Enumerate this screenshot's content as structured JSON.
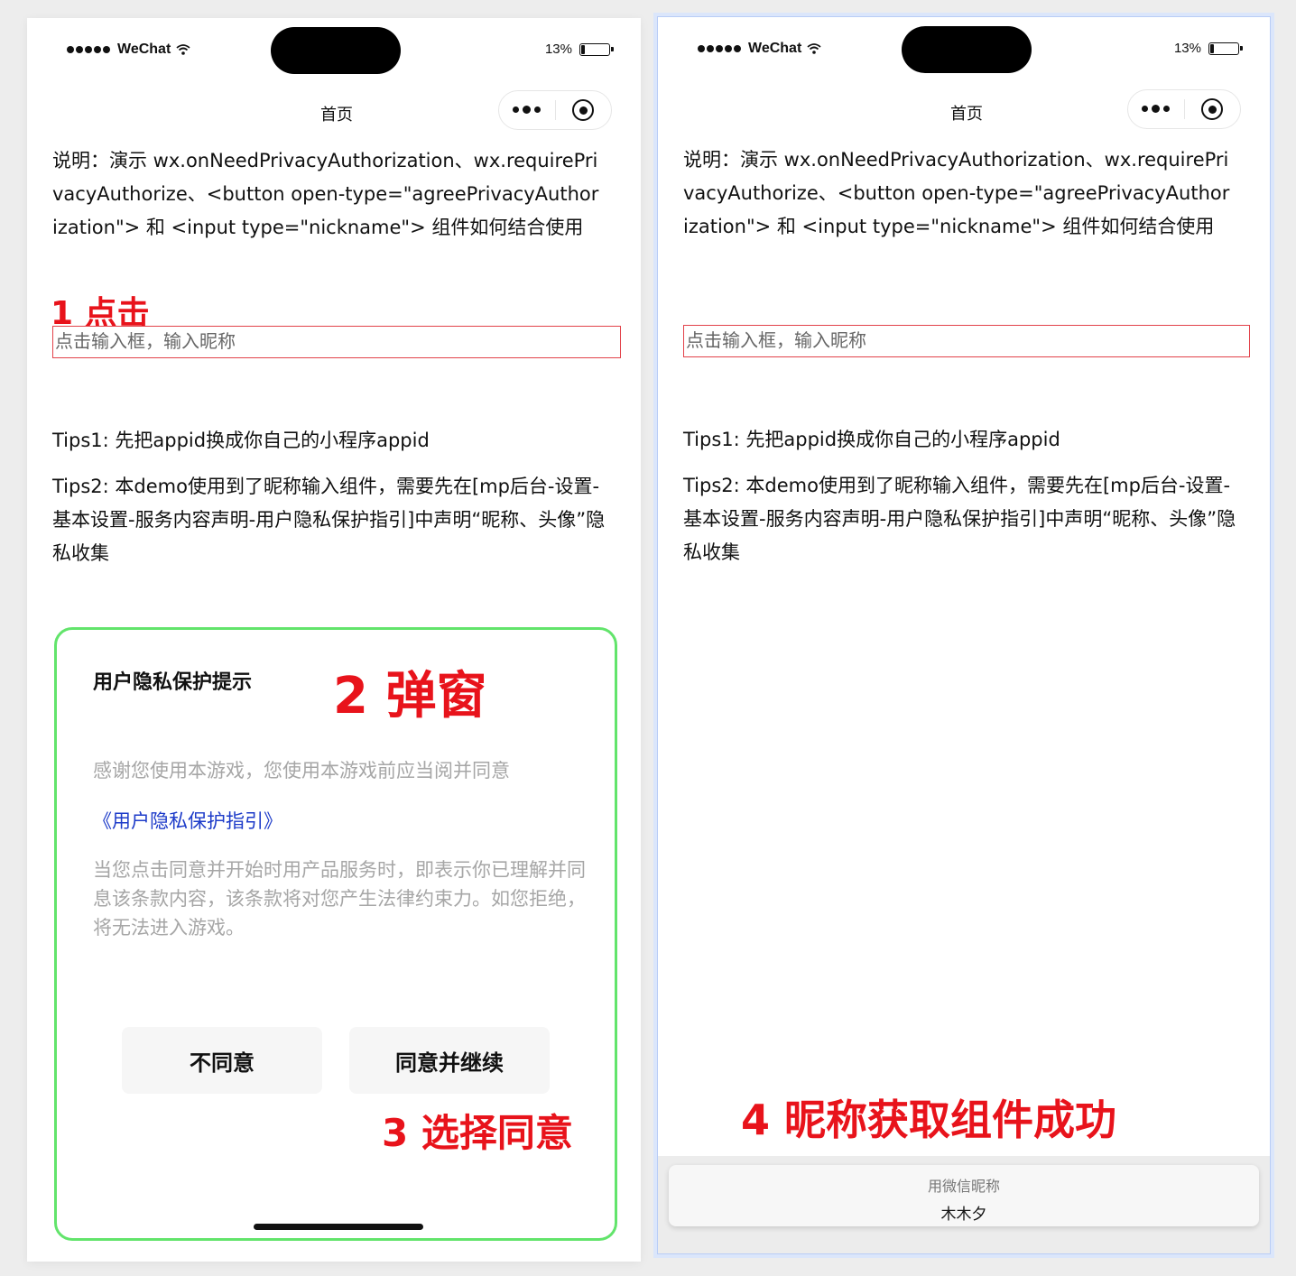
{
  "status_bar": {
    "carrier": "WeChat",
    "battery": "13%",
    "battery_level": 0.13
  },
  "nav": {
    "title": "首页"
  },
  "description": "说明：演示 wx.onNeedPrivacyAuthorization、wx.requirePrivacyAuthorize、<button open-type=\"agreePrivacyAuthorization\"> 和 <input type=\"nickname\"> 组件如何结合使用",
  "input": {
    "placeholder": "点击输入框，输入昵称"
  },
  "tips": {
    "tips1": "Tips1: 先把appid换成你自己的小程序appid",
    "tips2": "Tips2: 本demo使用到了昵称输入组件，需要先在[mp后台-设置-基本设置-服务内容声明-用户隐私保护指引]中声明“昵称、头像”隐私收集"
  },
  "annotations": {
    "step1": "1 点击",
    "step2": "2 弹窗",
    "step3": "3 选择同意",
    "step4": "4 昵称获取组件成功"
  },
  "popup": {
    "title": "用户隐私保护提示",
    "text1": "感谢您使用本游戏，您使用本游戏前应当阅并同意",
    "link": "《用户隐私保护指引》",
    "text2": "当您点击同意并开始时用产品服务时，即表示你已理解并同息该条款内容，该条款将对您产生法律约束力。如您拒绝，将无法进入游戏。",
    "disagree": "不同意",
    "agree": "同意并继续"
  },
  "nickname_suggestion": {
    "label": "用微信昵称",
    "value": "木木夕"
  },
  "colors": {
    "annotation": "#e8131b",
    "popup_border": "#62e46b",
    "link": "#1d3bc9",
    "input_border": "#e2424a"
  }
}
